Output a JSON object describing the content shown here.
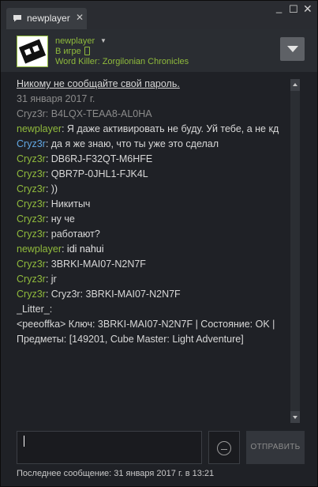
{
  "tab": {
    "label": "newplayer",
    "close": "✕",
    "icon": "chat-bubble-icon"
  },
  "window_controls": {
    "minimize": "_",
    "maximize": "☐",
    "close": "✕"
  },
  "header": {
    "name": "newplayer",
    "status": "В игре",
    "game": "Word Killer: Zorgilonian Chronicles",
    "accent_color": "#90ba3c"
  },
  "messages": [
    {
      "type": "notice",
      "text": "Никому не сообщайте свой пароль."
    },
    {
      "type": "date",
      "text": "31 января 2017 г."
    },
    {
      "type": "old",
      "text": "Cryz3r: B4LQX-TEAA8-AL0HA"
    },
    {
      "sender": "newplayer",
      "sender_color": "green",
      "text": ": Я даже активировать не буду. Уй тебе, а не кд"
    },
    {
      "sender": "Cryz3r",
      "sender_color": "blue",
      "text": ": да я же знаю, что ты уже это сделал"
    },
    {
      "sender": "Cryz3r",
      "sender_color": "green",
      "text": ": DB6RJ-F32QT-M6HFE"
    },
    {
      "sender": "Cryz3r",
      "sender_color": "green",
      "text": ": QBR7P-0JHL1-FJK4L"
    },
    {
      "sender": "Cryz3r",
      "sender_color": "green",
      "text": ": ))"
    },
    {
      "sender": "Cryz3r",
      "sender_color": "green",
      "text": ": Никитыч"
    },
    {
      "sender": "Cryz3r",
      "sender_color": "green",
      "text": ": ну че"
    },
    {
      "sender": "Cryz3r",
      "sender_color": "green",
      "text": ": работают?"
    },
    {
      "sender": "newplayer",
      "sender_color": "green",
      "text": ": idi nahui"
    },
    {
      "sender": "Cryz3r",
      "sender_color": "green",
      "text": ": 3BRKI-MAI07-N2N7F"
    },
    {
      "sender": "Cryz3r",
      "sender_color": "green",
      "text": ": jr"
    },
    {
      "sender": "Cryz3r",
      "sender_color": "green",
      "text": ": Cryz3r: 3BRKI-MAI07-N2N7F"
    },
    {
      "type": "plain",
      "text": "_Litter_:"
    },
    {
      "type": "plain",
      "text": "<peeoffka> Ключ: 3BRKI-MAI07-N2N7F | Состояние: OK | Предметы: [149201, Cube Master: Light Adventure]"
    }
  ],
  "input": {
    "value": ""
  },
  "send_button": {
    "label": "ОТПРАВИТЬ"
  },
  "footer": {
    "last_message": "Последнее сообщение: 31 января 2017 г. в 13:21"
  }
}
